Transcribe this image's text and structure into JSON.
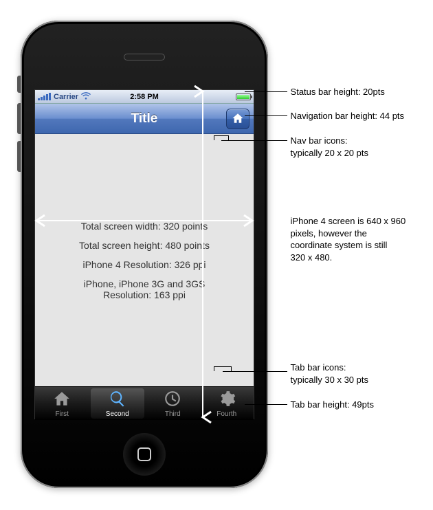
{
  "statusBar": {
    "carrier": "Carrier",
    "time": "2:58 PM"
  },
  "navBar": {
    "title": "Title"
  },
  "content": {
    "widthLine": "Total screen width: 320 points",
    "heightLine": "Total screen height: 480 points",
    "res4Line": "iPhone 4 Resolution: 326 ppi",
    "resOldLine1": "iPhone, iPhone 3G and 3GS",
    "resOldLine2": "Resolution: 163 ppi"
  },
  "tabs": [
    {
      "label": "First"
    },
    {
      "label": "Second"
    },
    {
      "label": "Third"
    },
    {
      "label": "Fourth"
    }
  ],
  "annotations": {
    "statusBar": "Status bar height: 20pts",
    "navBar": "Navigation bar height: 44 pts",
    "navIcons1": "Nav bar icons:",
    "navIcons2": "typically 20 x 20 pts",
    "screen1": "iPhone 4 screen is 640 x 960",
    "screen2": "pixels, however the",
    "screen3": "coordinate system is still",
    "screen4": "320 x 480.",
    "tabIcons1": "Tab bar icons:",
    "tabIcons2": "typically 30 x 30 pts",
    "tabBar": "Tab bar height: 49pts"
  }
}
